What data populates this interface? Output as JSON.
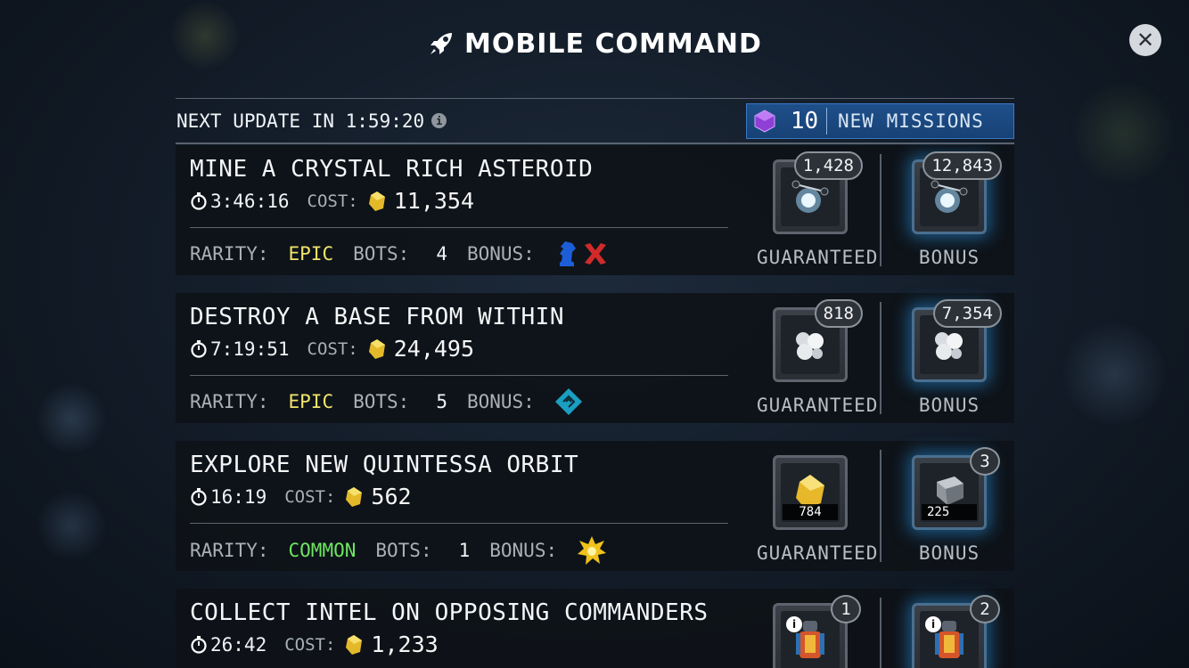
{
  "header": {
    "title": "MOBILE COMMAND",
    "close_label": "✕"
  },
  "topbar": {
    "next_update_label": "NEXT UPDATE IN 1:59:20",
    "new_missions_count": "10",
    "new_missions_label": "NEW MISSIONS"
  },
  "labels": {
    "cost": "COST:",
    "rarity": "RARITY:",
    "bots": "BOTS:",
    "bonus": "BONUS:",
    "guaranteed": "GUARANTEED",
    "bonus_reward": "BONUS"
  },
  "missions": [
    {
      "name": "MINE A CRYSTAL RICH ASTEROID",
      "time": "3:46:16",
      "cost": "11,354",
      "rarity": "EPIC",
      "bots": "4",
      "guaranteed_amount": "1,428",
      "bonus_amount": "12,843"
    },
    {
      "name": "DESTROY A BASE FROM WITHIN",
      "time": "7:19:51",
      "cost": "24,495",
      "rarity": "EPIC",
      "bots": "5",
      "guaranteed_amount": "818",
      "bonus_amount": "7,354"
    },
    {
      "name": "EXPLORE NEW QUINTESSA ORBIT",
      "time": "16:19",
      "cost": "562",
      "rarity": "COMMON",
      "bots": "1",
      "guaranteed_amount": "784",
      "bonus_amount": "225",
      "bonus_badge": "3"
    },
    {
      "name": "COLLECT INTEL ON OPPOSING COMMANDERS",
      "time": "26:42",
      "cost": "1,233",
      "guaranteed_badge": "1",
      "bonus_badge": "2"
    }
  ],
  "colors": {
    "epic": "#f0e46a",
    "common": "#6ee660",
    "new_missions_bg": "#1f4f8a",
    "bonus_glow": "#2896e6"
  }
}
